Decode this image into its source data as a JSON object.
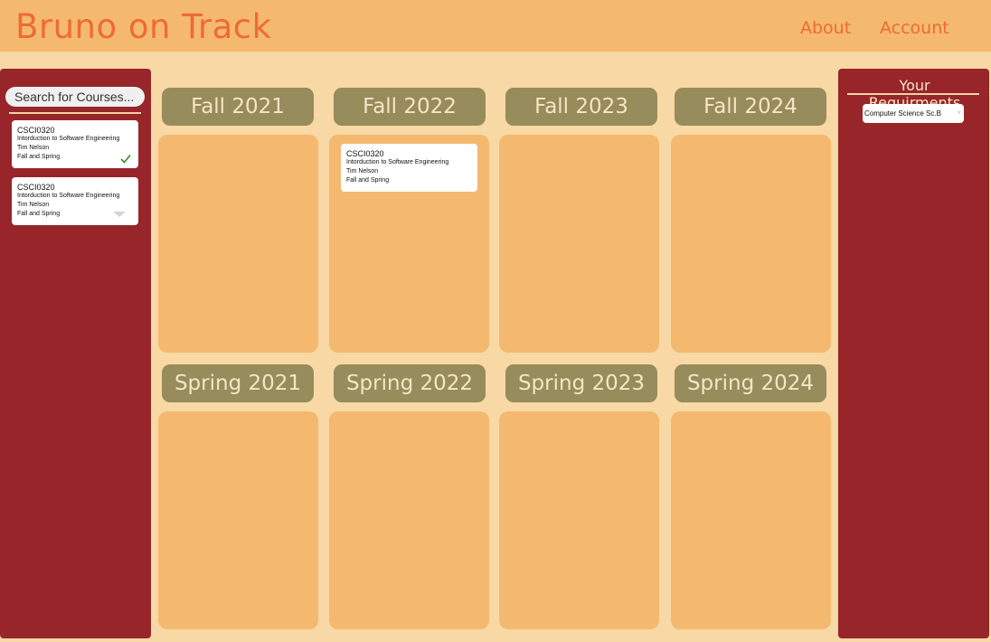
{
  "header": {
    "app_title": "Bruno on Track",
    "nav": {
      "about": "About",
      "account": "Account"
    }
  },
  "sidebar": {
    "search_placeholder": "Search for Courses...",
    "courses": [
      {
        "code": "CSCI0320",
        "title": "Intorduction to Software Engineering",
        "instructor": "Tim Nelson",
        "offered": "Fall and Spring",
        "status_icon": "check-icon"
      },
      {
        "code": "CSCI0320",
        "title": "Intorduction to Software Engineering",
        "instructor": "Tim Nelson",
        "offered": "Fall and Spring",
        "status_icon": "chevron-down-icon"
      }
    ]
  },
  "semesters": {
    "fall": [
      "Fall 2021",
      "Fall 2022",
      "Fall 2023",
      "Fall 2024"
    ],
    "spring": [
      "Spring 2021",
      "Spring 2022",
      "Spring 2023",
      "Spring 2024"
    ]
  },
  "planned_courses": {
    "fall_2022": [
      {
        "code": "CSCI0320",
        "title": "Intorduction to Software Engineering",
        "instructor": "Tim Nelson",
        "offered": "Fall and Spring"
      }
    ]
  },
  "requirements": {
    "title": "Your Requirments",
    "items": [
      {
        "label": "Computer Science Sc.B",
        "remove": "×"
      }
    ]
  },
  "colors": {
    "page_bg": "#f8d8a4",
    "header_bg": "#f4b96f",
    "accent_orange": "#ee6b35",
    "panel_red": "#97252a",
    "term_header": "#978c5b",
    "term_box": "#f4b96f",
    "check_green": "#3a8a2a"
  }
}
